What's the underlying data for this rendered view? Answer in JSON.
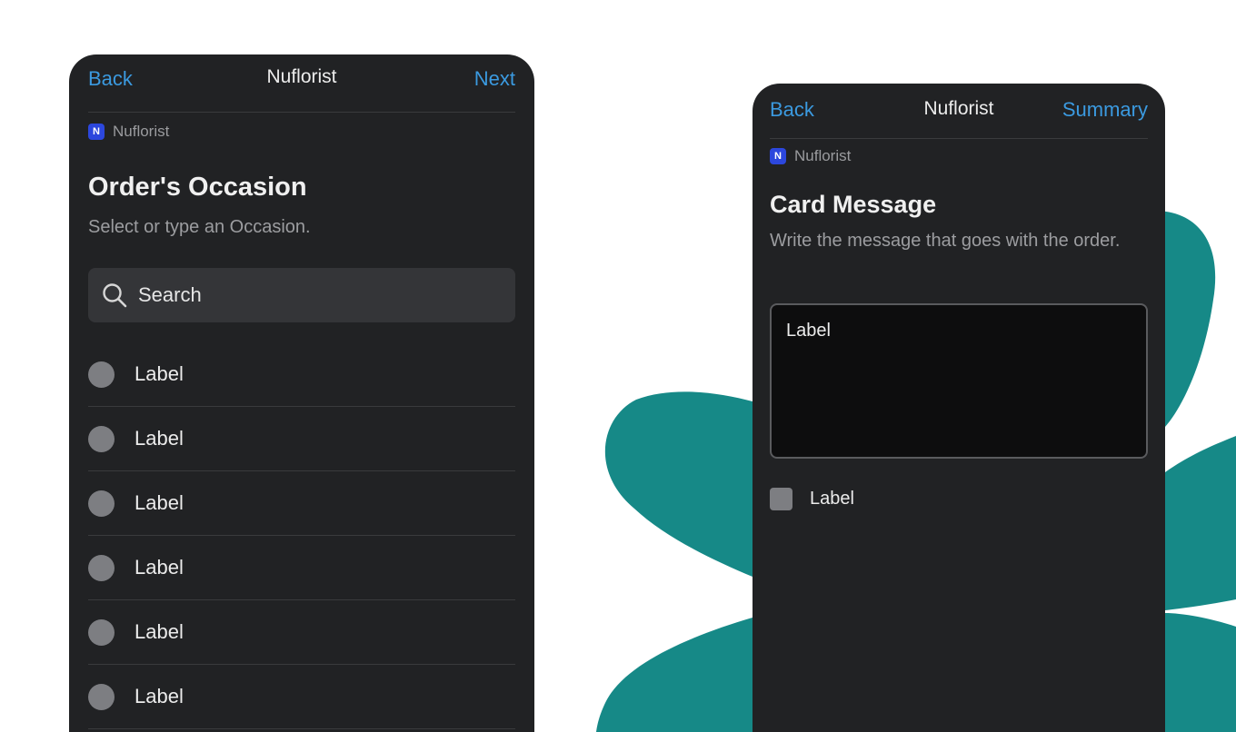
{
  "colors": {
    "accent": "#3b9ae0",
    "panel_background": "#212224",
    "backdrop_shape": "#168987",
    "app_logo": "#2c47dd"
  },
  "left_screen": {
    "nav": {
      "back_label": "Back",
      "title": "Nuflorist",
      "next_label": "Next"
    },
    "app_tag": {
      "logo_text": "N",
      "name": "Nuflorist"
    },
    "heading": "Order's Occasion",
    "subtitle": "Select or type an Occasion.",
    "search": {
      "icon": "search-icon",
      "placeholder": "Search"
    },
    "options": [
      {
        "label": "Label"
      },
      {
        "label": "Label"
      },
      {
        "label": "Label"
      },
      {
        "label": "Label"
      },
      {
        "label": "Label"
      },
      {
        "label": "Label"
      }
    ]
  },
  "right_screen": {
    "nav": {
      "back_label": "Back",
      "title": "Nuflorist",
      "next_label": "Summary"
    },
    "app_tag": {
      "logo_text": "N",
      "name": "Nuflorist"
    },
    "heading": "Card Message",
    "subtitle": "Write the message that goes with the order.",
    "message_field": {
      "value": "Label"
    },
    "checkbox": {
      "label": "Label",
      "checked": false
    }
  }
}
